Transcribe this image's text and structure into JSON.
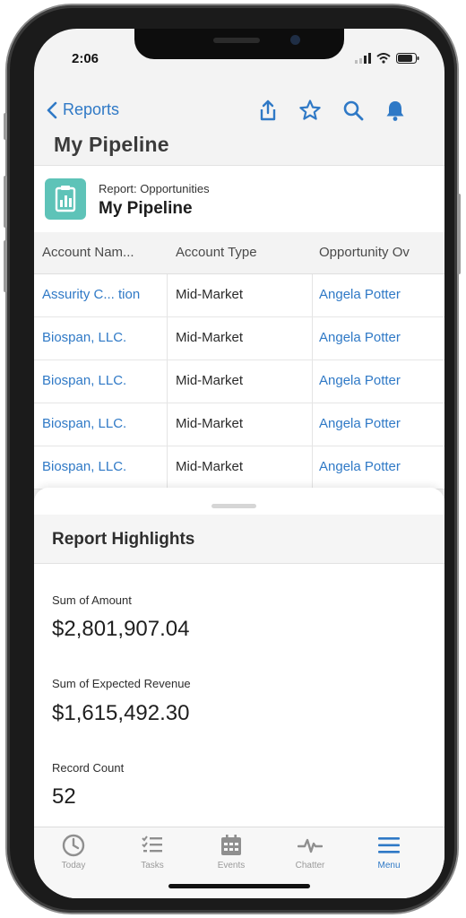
{
  "status": {
    "time": "2:06"
  },
  "nav": {
    "back_label": "Reports"
  },
  "page": {
    "title": "My Pipeline"
  },
  "report": {
    "subtitle": "Report: Opportunities",
    "name": "My Pipeline"
  },
  "table": {
    "headers": [
      "Account Nam...",
      "Account Type",
      "Opportunity Ov"
    ],
    "rows": [
      [
        "Assurity C...  tion",
        "Mid-Market",
        "Angela Potter"
      ],
      [
        "Biospan, LLC.",
        "Mid-Market",
        "Angela Potter"
      ],
      [
        "Biospan, LLC.",
        "Mid-Market",
        "Angela Potter"
      ],
      [
        "Biospan, LLC.",
        "Mid-Market",
        "Angela Potter"
      ],
      [
        "Biospan, LLC.",
        "Mid-Market",
        "Angela Potter"
      ]
    ]
  },
  "highlights": {
    "title": "Report Highlights",
    "metrics": [
      {
        "label": "Sum of Amount",
        "value": "$2,801,907.04"
      },
      {
        "label": "Sum of Expected Revenue",
        "value": "$1,615,492.30"
      },
      {
        "label": "Record Count",
        "value": "52"
      }
    ]
  },
  "tabs": [
    {
      "label": "Today",
      "icon": "clock-icon",
      "active": false
    },
    {
      "label": "Tasks",
      "icon": "tasks-icon",
      "active": false
    },
    {
      "label": "Events",
      "icon": "calendar-icon",
      "active": false
    },
    {
      "label": "Chatter",
      "icon": "pulse-icon",
      "active": false
    },
    {
      "label": "Menu",
      "icon": "menu-icon",
      "active": true
    }
  ],
  "colors": {
    "accent": "#2f79c6",
    "report_icon": "#5ec3b8"
  }
}
